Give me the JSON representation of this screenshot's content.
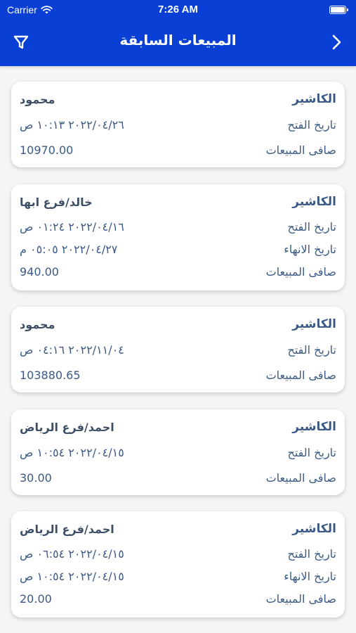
{
  "status": {
    "carrier": "Carrier",
    "time": "7:26 AM"
  },
  "header": {
    "title": "المبيعات السابقة"
  },
  "cards": [
    {
      "cashier_label": "الكاشير",
      "cashier": "محمود",
      "open_label": "تاريخ الفتح",
      "open_date": "٢٠٢٢/٠٤/٢٦ ١٠:١٣ ص",
      "net_label": "صافى المبيعات",
      "net": "10970.00"
    },
    {
      "cashier_label": "الكاشير",
      "cashier": "خالد/فرع ابها",
      "open_label": "تاريخ الفتح",
      "open_date": "٢٠٢٢/٠٤/١٦ ٠١:٢٤ ص",
      "close_label": "تاريخ الانهاء",
      "close_date": "٢٠٢٢/٠٤/٢٧ ٠٥:٠٥ م",
      "net_label": "صافى المبيعات",
      "net": "940.00"
    },
    {
      "cashier_label": "الكاشير",
      "cashier": "محمود",
      "open_label": "تاريخ الفتح",
      "open_date": "٢٠٢٢/١١/٠٤ ٠٤:١٦ ص",
      "net_label": "صافى المبيعات",
      "net": "103880.65"
    },
    {
      "cashier_label": "الكاشير",
      "cashier": "احمد/فرع الرياض",
      "open_label": "تاريخ الفتح",
      "open_date": "٢٠٢٢/٠٤/١٥ ١٠:٥٤ ص",
      "net_label": "صافى المبيعات",
      "net": "30.00"
    },
    {
      "cashier_label": "الكاشير",
      "cashier": "احمد/فرع الرياض",
      "open_label": "تاريخ الفتح",
      "open_date": "٢٠٢٢/٠٤/١٥ ٠٦:٥٤ ص",
      "close_label": "تاريخ الانهاء",
      "close_date": "٢٠٢٢/٠٤/١٥ ١٠:٥٤ ص",
      "net_label": "صافى المبيعات",
      "net": "20.00"
    }
  ]
}
